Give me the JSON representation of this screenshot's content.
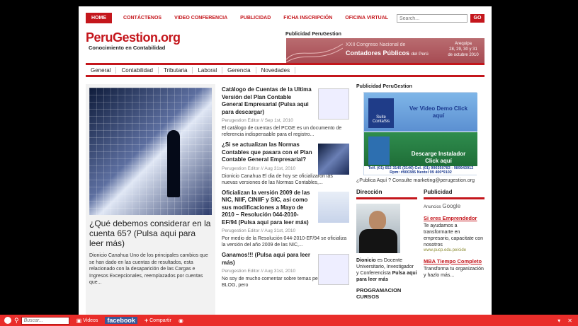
{
  "nav": {
    "items": [
      "HOME",
      "CONTÁCTENOS",
      "VIDEO CONFERENCIA",
      "PUBLICIDAD",
      "FICHA INSCRIPCIÓN",
      "OFICINA VIRTUAL"
    ],
    "search_placeholder": "Search...",
    "go_label": "GO"
  },
  "header": {
    "logo": "PeruGestion.org",
    "tagline": "Conocimiento en Contabilidad",
    "publicidad_title": "Publicidad PeruGestion",
    "banner_line1": "XXII Congreso Nacional de",
    "banner_line2": "Contadores Públicos",
    "banner_line2b": "del Perú",
    "banner_place": "Arequipa",
    "banner_dates": "28, 29, 30 y 31",
    "banner_month": "de octubre 2010"
  },
  "categories": [
    "General",
    "Contabilidad",
    "Tributaria",
    "Laboral",
    "Gerencia",
    "Novedades"
  ],
  "featured": {
    "title": "¿Qué debemos considerar en la cuenta 65? (Pulsa aqui para leer más)",
    "desc": "Dionicio Canahua Uno de los principales cambios que se han dado en las cuentas de resultados, esta relacionado con la desaparición de las Cargas e Ingresos Excepcionales, reemplazados por cuentas que..."
  },
  "articles": [
    {
      "title": "Catálogo de Cuentas de la Ultima Versión del Plan Contable General Empresarial (Pulsa aqui para descargar)",
      "meta": "Perugestion Editor // Sep 1st, 2010",
      "desc": "El catálogo de cuentas del PCGE es un documento de referencia indispensable para el registro..."
    },
    {
      "title": "¿Si se actualizan las Normas Contables que pasara con el Plan Contable General Empresarial?",
      "meta": "Perugestion Editor // Aug 31st, 2010",
      "desc": "Dionicio Canahua El dia de hoy se oficializaron las nuevas versiones de las Normas Contables,..."
    },
    {
      "title": "Oficializan la versión 2009 de las NIC, NIIF, CINIIF y SIC, así como sus modificaciones a Mayo de 2010 – Resolución 044-2010-EF/94 (Pulsa aqui para leer más)",
      "meta": "Perugestion Editor // Aug 31st, 2010",
      "desc": "Por medio de la Resolución 044-2010-EF/94 se oficializa la versión del año 2009 de las NIC,..."
    },
    {
      "title": "Ganamos!!! (Pulsa aqui para leer más)",
      "meta": "Perugestion Editor // Aug 31st, 2010",
      "desc": "No soy de mucho comentar sobre temas personales en el BLOG, pero"
    }
  ],
  "sidebar": {
    "title": "Publicidad PeruGestion",
    "ad_brand": "Suite ContaSis",
    "ad_text1": "Ver Video Demo Click aquí",
    "ad_text2": "Descarge Instalador Click aquí",
    "ad_footer": "Telf. (01) 652 3145 (3146) Cel. (01) 990350783 - 989943912 Rpm: #900385 Nextel 99 400*9102",
    "publica": "¿Publica Aquí ? Consulte marketing@perugestion.org",
    "direccion_head": "Dirección",
    "direccion_name": "Dionicio",
    "direccion_text": "es Docente Universitario, Investigador y Conferencista",
    "direccion_link": "Pulsa aqui para leer más",
    "programacion": "PROGRAMACION CURSOS",
    "publicidad_head": "Publicidad",
    "anuncios": "Anuncios",
    "google": "Google",
    "ad1_title": "Si eres Emprendedor",
    "ad1_desc": "Te ayudamos a transformarte en empresario, capacitate con nosotros",
    "ad1_url": "www.pucp.edu.pe/cide",
    "ad2_title": "MBA Tiempo Completo",
    "ad2_desc": "Transforma tu organización y hazlo más..."
  },
  "toolbar": {
    "search_placeholder": "Buscar...",
    "videos": "Videos",
    "facebook": "facebook",
    "compartir": "Compartir"
  },
  "colors": {
    "accent": "#c4161c",
    "toolbar": "#e92d2a"
  }
}
